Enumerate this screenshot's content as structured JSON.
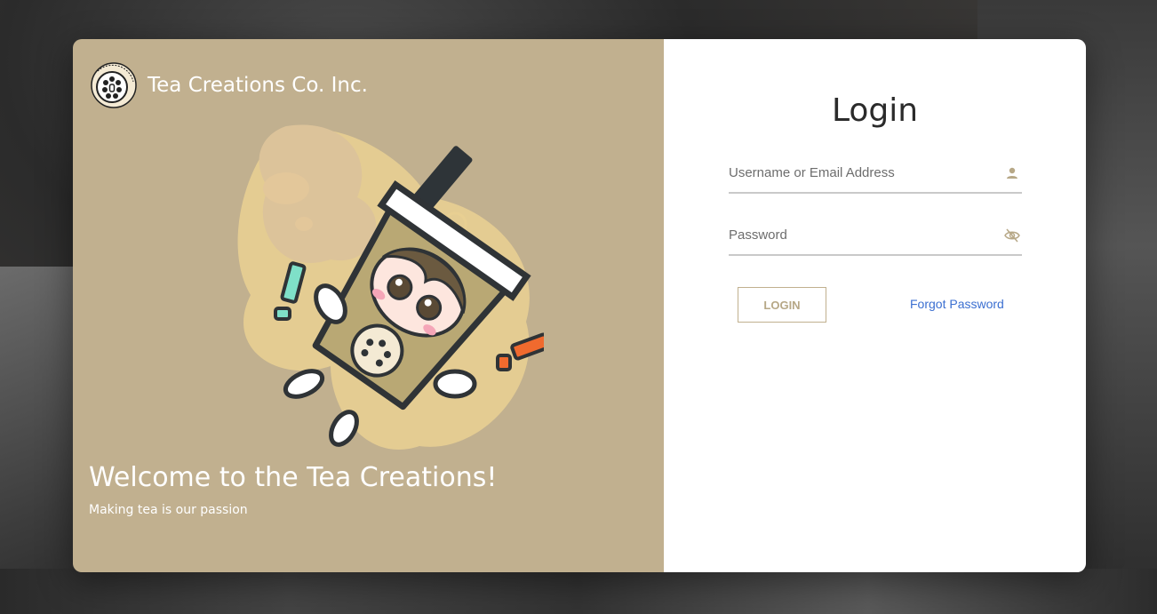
{
  "brand": {
    "name": "Tea Creations Co. Inc.",
    "logo_text": "Tea Creations Co. Inc."
  },
  "hero": {
    "welcome": "Welcome to the Tea Creations!",
    "tagline": "Making tea is our passion"
  },
  "login": {
    "title": "Login",
    "username_placeholder": "Username or Email Address",
    "password_placeholder": "Password",
    "submit_label": "LOGIN",
    "forgot_label": "Forgot Password"
  },
  "icons": {
    "username": "person-icon",
    "password": "eye-slash-icon"
  },
  "colors": {
    "panel": "#c1b08f",
    "accent_link": "#3b6fd1",
    "button_border": "#c1b08f"
  }
}
